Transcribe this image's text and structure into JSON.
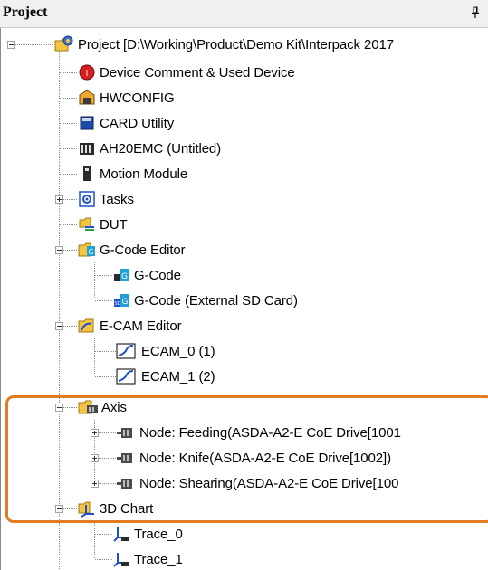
{
  "panel": {
    "title": "Project"
  },
  "tree": {
    "root": "Project [D:\\Working\\Product\\Demo Kit\\Interpack 2017",
    "items": {
      "device_comment": "Device Comment & Used Device",
      "hwconfig": "HWCONFIG",
      "card_utility": "CARD Utility",
      "ah20emc": "AH20EMC  (Untitled)",
      "motion_module": "Motion Module",
      "tasks": "Tasks",
      "dut": "DUT",
      "gcode_editor": "G-Code Editor",
      "gcode": "G-Code",
      "gcode_external": "G-Code (External SD Card)",
      "ecam_editor": "E-CAM Editor",
      "ecam_0": "ECAM_0 (1)",
      "ecam_1": "ECAM_1 (2)",
      "axis": "Axis",
      "node_feeding": "Node: Feeding(ASDA-A2-E CoE Drive[1001",
      "node_knife": "Node: Knife(ASDA-A2-E CoE Drive[1002])",
      "node_shearing": "Node: Shearing(ASDA-A2-E CoE Drive[100",
      "chart_3d": "3D Chart",
      "trace_0": "Trace_0",
      "trace_1": "Trace_1"
    }
  },
  "colors": {
    "highlight_border": "#e07c22",
    "folder_yellow": "#f4c542",
    "accent_blue": "#2050c8"
  }
}
